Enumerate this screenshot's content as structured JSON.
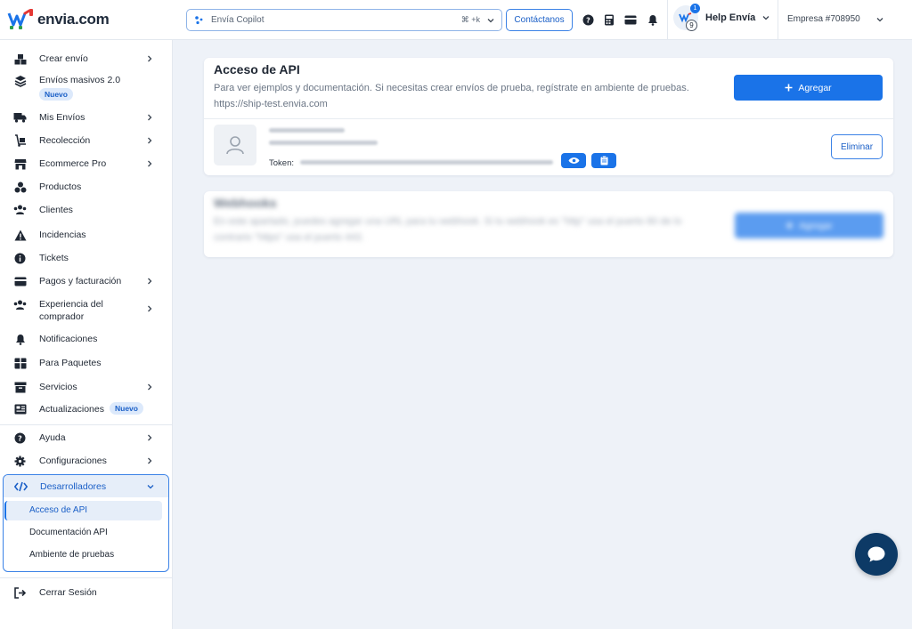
{
  "brand": {
    "name": "envia.com"
  },
  "topbar": {
    "copilot_label": "Envía Copilot",
    "copilot_shortcut": "⌘ +k",
    "contact_label": "Contáctanos",
    "help_badge_count": "1",
    "help_avatar_number": "9",
    "help_label": "Help Envía",
    "company_label": "Empresa #708950"
  },
  "sidebar": {
    "items": [
      {
        "label": "Crear envío"
      },
      {
        "label": "Envíos masivos 2.0",
        "badge": "Nuevo"
      },
      {
        "label": "Mis Envíos"
      },
      {
        "label": "Recolección"
      },
      {
        "label": "Ecommerce Pro"
      },
      {
        "label": "Productos"
      },
      {
        "label": "Clientes"
      },
      {
        "label": "Incidencias"
      },
      {
        "label": "Tickets"
      },
      {
        "label": "Pagos y facturación"
      },
      {
        "label": "Experiencia del comprador"
      },
      {
        "label": "Notificaciones"
      },
      {
        "label": "Para Paquetes"
      },
      {
        "label": "Servicios"
      },
      {
        "label": "Actualizaciones",
        "badge": "Nuevo"
      },
      {
        "label": "Ayuda"
      },
      {
        "label": "Configuraciones"
      },
      {
        "label": "Desarrolladores"
      }
    ],
    "dev_subitems": [
      {
        "label": "Acceso de API"
      },
      {
        "label": "Documentación API"
      },
      {
        "label": "Ambiente de pruebas"
      }
    ],
    "logout_label": "Cerrar Sesión"
  },
  "api_card": {
    "title": "Acceso de API",
    "description": "Para ver ejemplos y documentación. Si necesitas crear envíos de prueba, regístrate en ambiente de pruebas. https://ship-test.envia.com",
    "add_label": "Agregar",
    "token_label": "Token:",
    "delete_label": "Eliminar"
  },
  "webhooks_card": {
    "title": "Webhooks",
    "description": "En este apartado, puedes agregar una URL para tu webhook. Si tu webhook es \"http\" usa el puerto 80 de lo contrario \"https\" usa el puerto 443.",
    "add_label": "Agregar"
  },
  "colors": {
    "primary": "#1a73e8",
    "chat": "#0d3a66",
    "background": "#eef2f8"
  }
}
